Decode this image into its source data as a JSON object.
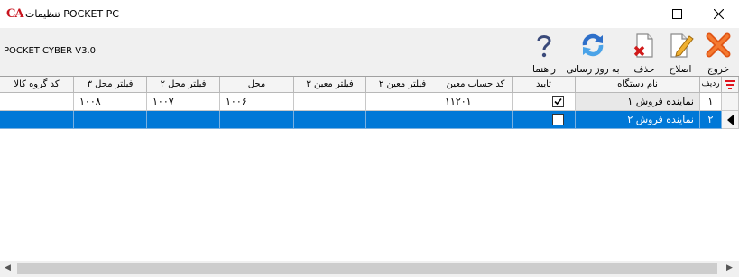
{
  "window": {
    "logo": "CA",
    "title": "تنظیمات POCKET PC",
    "version": "POCKET CYBER V3.0"
  },
  "toolbar": {
    "exit_label": "خروج",
    "edit_label": "اصلاح",
    "delete_label": "حذف",
    "refresh_label": "به روز رسانی",
    "help_label": "راهنما"
  },
  "grid": {
    "headers": {
      "rownum": "ردیف",
      "device_name": "نام دستگاه",
      "approve": "تایید",
      "account_code": "کد حساب معین",
      "filter_moein2": "فیلتر معین ۲",
      "filter_moein3": "فیلتر معین ۳",
      "location": "محل",
      "filter_loc2": "فیلتر محل ۲",
      "filter_loc3": "فیلتر محل ۳",
      "group_code": "کد گروه کالا"
    },
    "rows": [
      {
        "rownum": "۱",
        "device_name": "نماینده فروش ۱",
        "approved": true,
        "account_code": "۱۱۲۰۱",
        "filter_moein2": "",
        "filter_moein3": "",
        "location": "۱۰۰۶",
        "filter_loc2": "۱۰۰۷",
        "filter_loc3": "۱۰۰۸",
        "group_code": ""
      },
      {
        "rownum": "۲",
        "device_name": "نماینده فروش ۲",
        "approved": false,
        "account_code": "",
        "filter_moein2": "",
        "filter_moein3": "",
        "location": "",
        "filter_loc2": "",
        "filter_loc3": "",
        "group_code": ""
      }
    ]
  },
  "colors": {
    "selection": "#0078d7",
    "filter_icon": "#e0141e"
  }
}
